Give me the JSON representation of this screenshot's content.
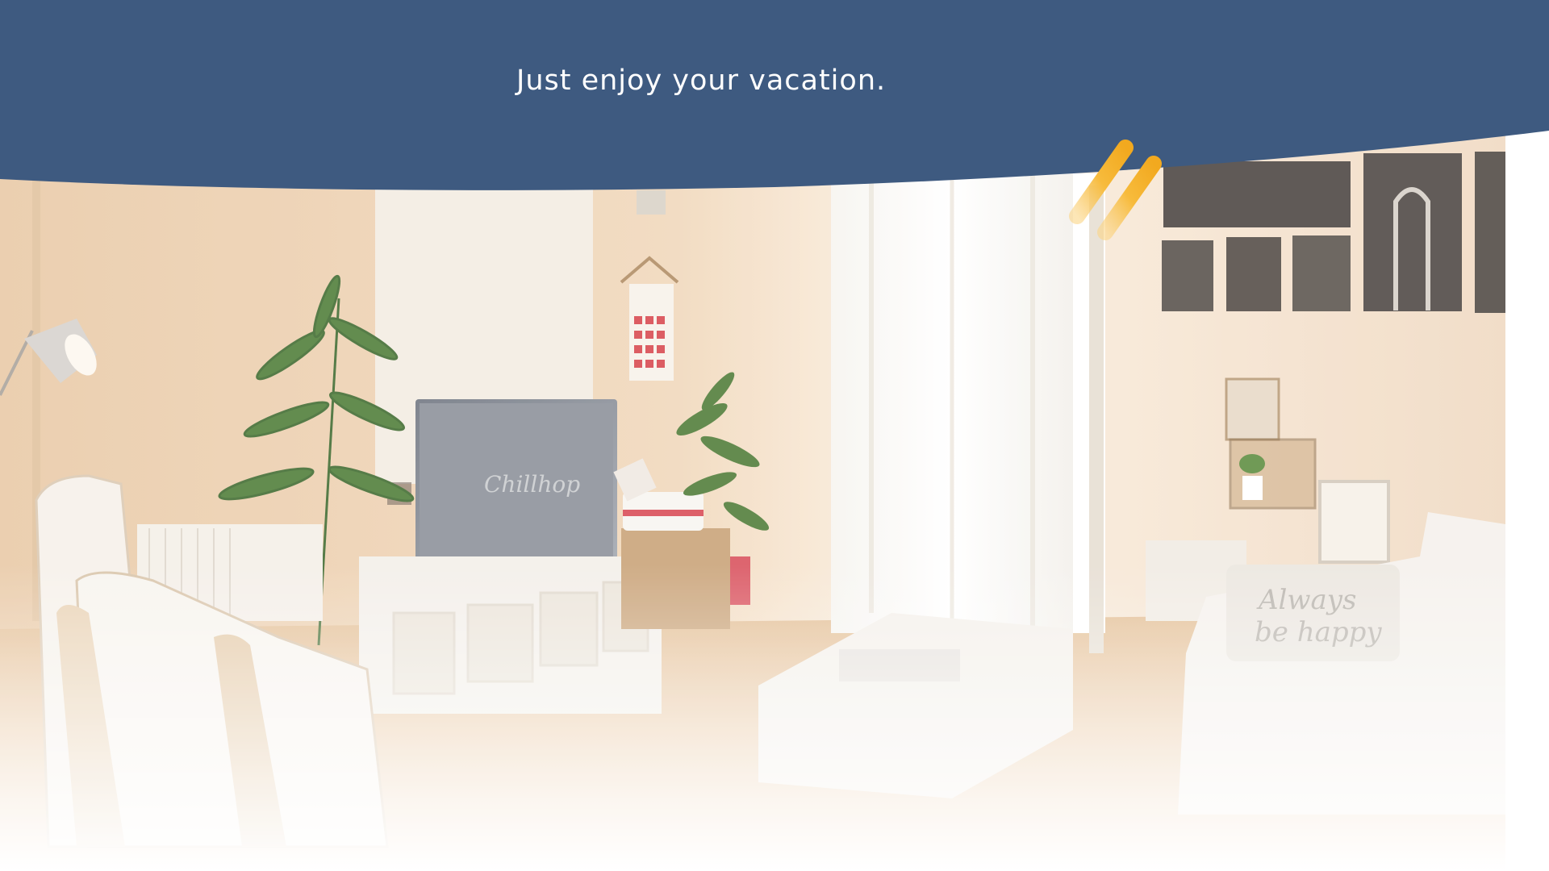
{
  "header": {
    "tagline": "Just enjoy your vacation.",
    "band_color": "#3e5a80"
  },
  "hero": {
    "image": "living-room-photo"
  },
  "accent": {
    "icon": "diagonal-stripes-icon",
    "color": "#f4b02a"
  }
}
